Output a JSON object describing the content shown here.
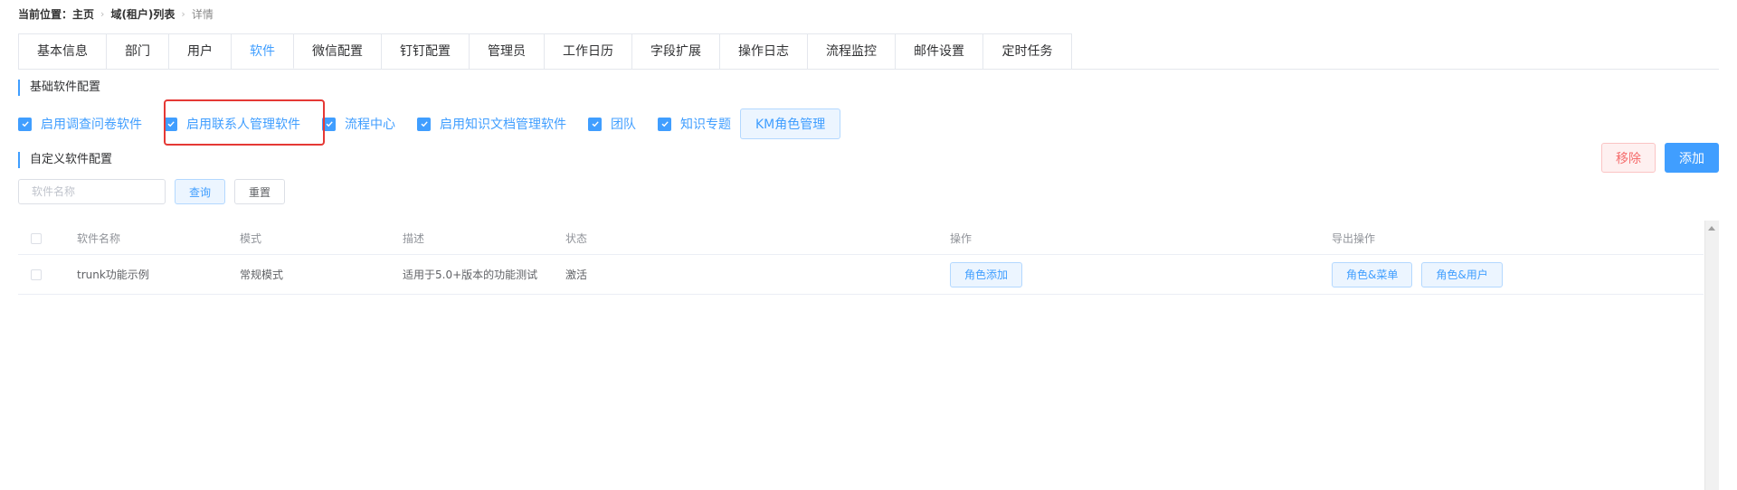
{
  "breadcrumb": {
    "label": "当前位置：",
    "items": [
      "主页",
      "域(租户)列表"
    ],
    "current": "详情"
  },
  "tabs": [
    {
      "label": "基本信息",
      "active": false
    },
    {
      "label": "部门",
      "active": false
    },
    {
      "label": "用户",
      "active": false
    },
    {
      "label": "软件",
      "active": true
    },
    {
      "label": "微信配置",
      "active": false
    },
    {
      "label": "钉钉配置",
      "active": false
    },
    {
      "label": "管理员",
      "active": false
    },
    {
      "label": "工作日历",
      "active": false
    },
    {
      "label": "字段扩展",
      "active": false
    },
    {
      "label": "操作日志",
      "active": false
    },
    {
      "label": "流程监控",
      "active": false
    },
    {
      "label": "邮件设置",
      "active": false
    },
    {
      "label": "定时任务",
      "active": false
    }
  ],
  "basic_config": {
    "title": "基础软件配置",
    "checkboxes": [
      {
        "label": "启用调查问卷软件",
        "checked": true
      },
      {
        "label": "启用联系人管理软件",
        "checked": true
      },
      {
        "label": "流程中心",
        "checked": true
      },
      {
        "label": "启用知识文档管理软件",
        "checked": true
      },
      {
        "label": "团队",
        "checked": true
      },
      {
        "label": "知识专题",
        "checked": true
      }
    ],
    "km_button": "KM角色管理"
  },
  "custom_config": {
    "title": "自定义软件配置",
    "remove_label": "移除",
    "add_label": "添加",
    "search": {
      "placeholder": "软件名称",
      "value": ""
    },
    "query_label": "查询",
    "reset_label": "重置"
  },
  "table": {
    "headers": {
      "name": "软件名称",
      "mode": "模式",
      "desc": "描述",
      "status": "状态",
      "ops": "操作",
      "export": "导出操作"
    },
    "rows": [
      {
        "name": "trunk功能示例",
        "mode": "常规模式",
        "desc": "适用于5.0+版本的功能测试",
        "status": "激活",
        "op_button": "角色添加",
        "export_buttons": [
          "角色&菜单",
          "角色&用户"
        ]
      }
    ]
  },
  "colors": {
    "accent": "#409eff",
    "danger": "#f56c6c",
    "highlight_box": "#e53935"
  }
}
